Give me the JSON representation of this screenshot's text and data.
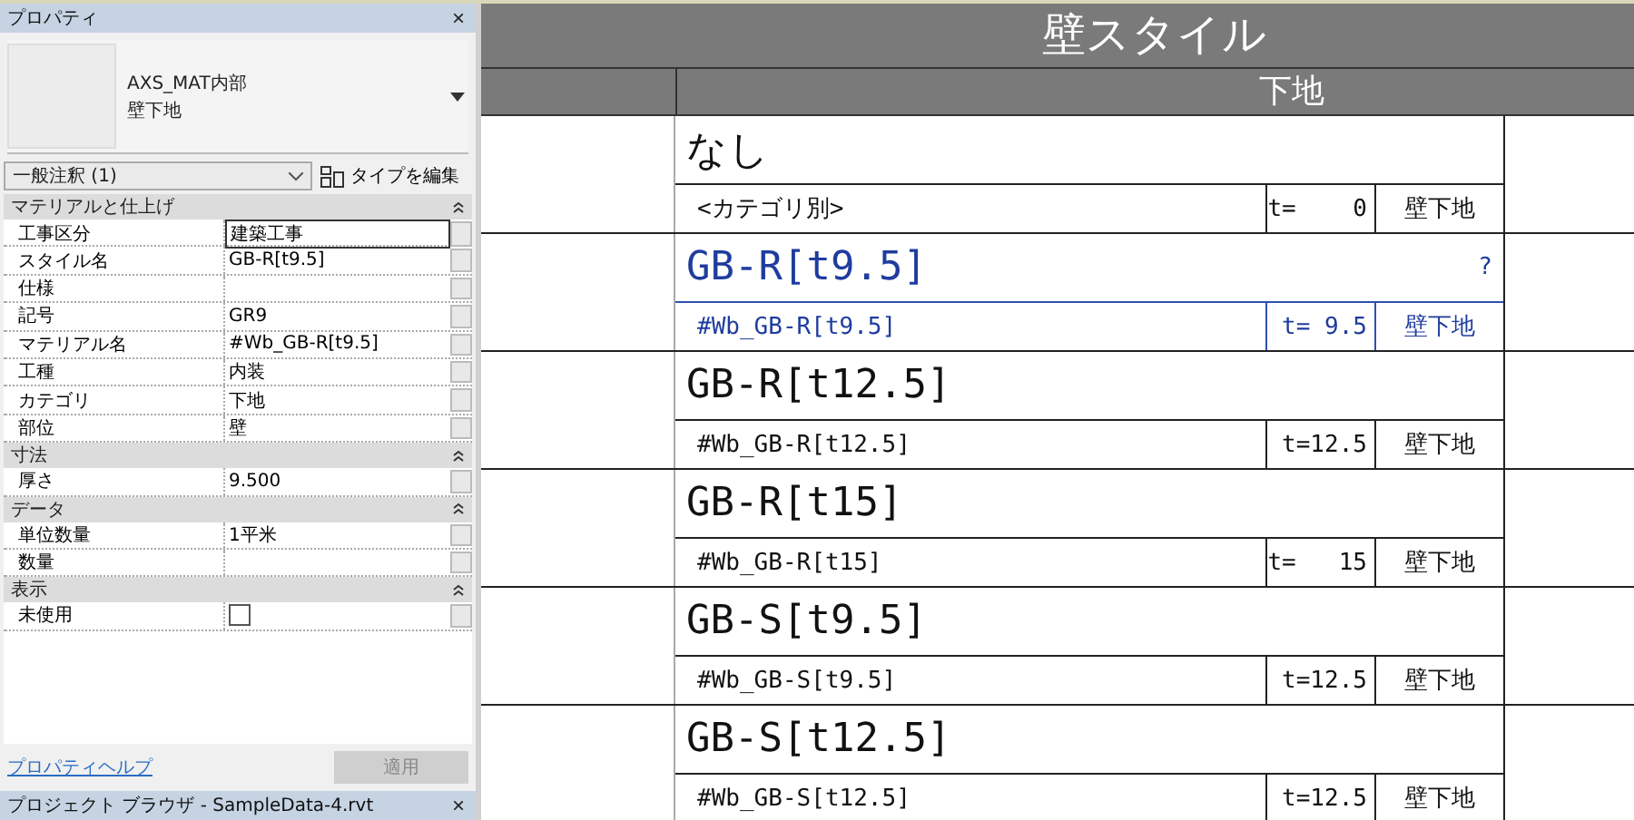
{
  "properties_panel": {
    "title": "プロパティ",
    "close": "×",
    "type_preview": {
      "family": "AXS_MAT内部",
      "type": "壁下地"
    },
    "instance_filter": "一般注釈 (1)",
    "edit_type_button": "タイプを編集",
    "groups": [
      {
        "label": "マテリアルと仕上げ",
        "expanded": true,
        "rows": [
          {
            "kind": "text",
            "label": "工事区分",
            "value": "建築工事",
            "editing": true
          },
          {
            "kind": "text",
            "label": "スタイル名",
            "value": "GB-R[t9.5]",
            "editing": false
          },
          {
            "kind": "text",
            "label": "仕様",
            "value": "",
            "editing": false
          },
          {
            "kind": "text",
            "label": "記号",
            "value": "GR9",
            "editing": false
          },
          {
            "kind": "text",
            "label": "マテリアル名",
            "value": "#Wb_GB-R[t9.5]",
            "editing": false
          },
          {
            "kind": "text",
            "label": "工種",
            "value": "内装",
            "editing": false
          },
          {
            "kind": "text",
            "label": "カテゴリ",
            "value": "下地",
            "editing": false
          },
          {
            "kind": "text",
            "label": "部位",
            "value": "壁",
            "editing": false
          }
        ]
      },
      {
        "label": "寸法",
        "expanded": true,
        "rows": [
          {
            "kind": "text",
            "label": "厚さ",
            "value": "9.500",
            "editing": false
          }
        ]
      },
      {
        "label": "データ",
        "expanded": true,
        "rows": [
          {
            "kind": "text",
            "label": "単位数量",
            "value": "1平米",
            "editing": false
          },
          {
            "kind": "text",
            "label": "数量",
            "value": "",
            "editing": false
          }
        ]
      },
      {
        "label": "表示",
        "expanded": true,
        "rows": [
          {
            "kind": "checkbox",
            "label": "未使用",
            "checked": false
          }
        ]
      }
    ],
    "help_link": "プロパティヘルプ",
    "apply_button": {
      "label": "適用",
      "disabled": true
    }
  },
  "project_browser": {
    "title": "プロジェクト ブラウザ - SampleData-4.rvt",
    "close": "×"
  },
  "schedule": {
    "title": "壁スタイル",
    "header": "下地",
    "rows": [
      {
        "name": "なし",
        "material": "<カテゴリ別>",
        "thickness": "t=    0",
        "category": "壁下地",
        "selected": false
      },
      {
        "name": "GB-R[t9.5]",
        "material": "#Wb_GB-R[t9.5]",
        "thickness": "t= 9.5",
        "category": "壁下地",
        "selected": true,
        "mark": "?"
      },
      {
        "name": "GB-R[t12.5]",
        "material": "#Wb_GB-R[t12.5]",
        "thickness": "t=12.5",
        "category": "壁下地",
        "selected": false
      },
      {
        "name": "GB-R[t15]",
        "material": "#Wb_GB-R[t15]",
        "thickness": "t=   15",
        "category": "壁下地",
        "selected": false
      },
      {
        "name": "GB-S[t9.5]",
        "material": "#Wb_GB-S[t9.5]",
        "thickness": "t=12.5",
        "category": "壁下地",
        "selected": false
      },
      {
        "name": "GB-S[t12.5]",
        "material": "#Wb_GB-S[t12.5]",
        "thickness": "t=12.5",
        "category": "壁下地",
        "selected": false
      }
    ]
  }
}
